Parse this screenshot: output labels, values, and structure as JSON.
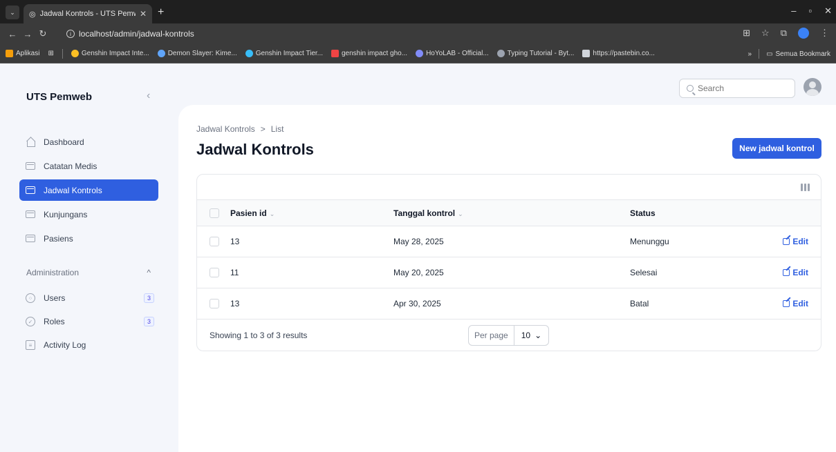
{
  "browser": {
    "tab_title": "Jadwal Kontrols - UTS Pemweb",
    "url": "localhost/admin/jadwal-kontrols",
    "bookmarks": [
      {
        "label": "Aplikasi",
        "color": "#f59e0b"
      },
      {
        "label": "Genshin Impact Inte...",
        "color": "#fbbf24"
      },
      {
        "label": "Demon Slayer: Kime...",
        "color": "#60a5fa"
      },
      {
        "label": "Genshin Impact Tier...",
        "color": "#38bdf8"
      },
      {
        "label": "genshin impact gho...",
        "color": "#ef4444"
      },
      {
        "label": "HoYoLAB - Official...",
        "color": "#818cf8"
      },
      {
        "label": "Typing Tutorial - Byt...",
        "color": "#9ca3af"
      },
      {
        "label": "https://pastebin.co...",
        "color": "#d1d5db"
      }
    ],
    "all_bookmarks": "Semua Bookmark"
  },
  "sidebar": {
    "brand": "UTS Pemweb",
    "items": [
      {
        "label": "Dashboard"
      },
      {
        "label": "Catatan Medis"
      },
      {
        "label": "Jadwal Kontrols"
      },
      {
        "label": "Kunjungans"
      },
      {
        "label": "Pasiens"
      }
    ],
    "group_title": "Administration",
    "group_items": [
      {
        "label": "Users",
        "badge": "3"
      },
      {
        "label": "Roles",
        "badge": "3"
      },
      {
        "label": "Activity Log"
      }
    ],
    "active_color": "#2f5fe0"
  },
  "header": {
    "search_placeholder": "Search"
  },
  "main": {
    "breadcrumb": [
      "Jadwal Kontrols",
      ">",
      "List"
    ],
    "title": "Jadwal Kontrols",
    "new_button": "New jadwal kontrol",
    "table": {
      "columns": [
        "Pasien id",
        "Tanggal kontrol",
        "Status"
      ],
      "rows": [
        {
          "pasien_id": "13",
          "tanggal": "May 28, 2025",
          "status": "Menunggu",
          "action": "Edit"
        },
        {
          "pasien_id": "11",
          "tanggal": "May 20, 2025",
          "status": "Selesai",
          "action": "Edit"
        },
        {
          "pasien_id": "13",
          "tanggal": "Apr 30, 2025",
          "status": "Batal",
          "action": "Edit"
        }
      ],
      "summary": "Showing 1 to 3 of 3 results",
      "per_page_label": "Per page",
      "per_page_value": "10"
    }
  }
}
